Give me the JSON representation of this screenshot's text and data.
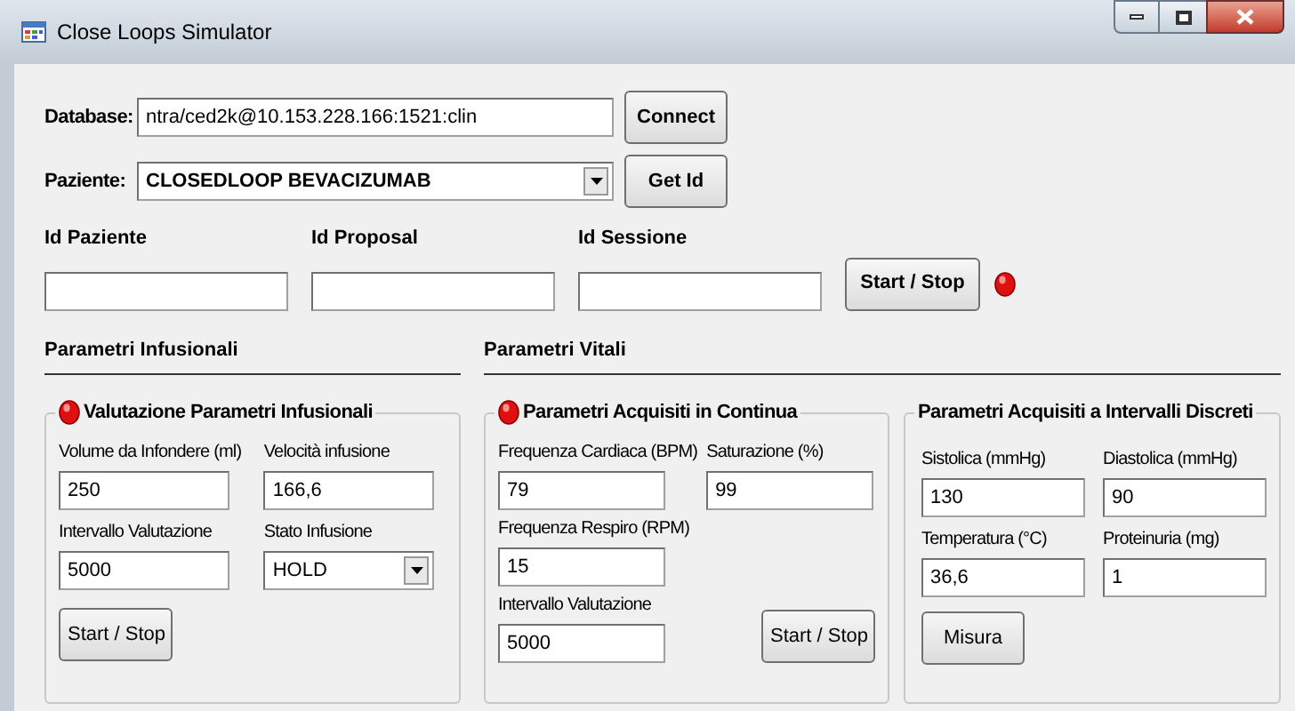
{
  "window": {
    "title": "Close Loops Simulator"
  },
  "database": {
    "label": "Database:",
    "value": "ntra/ced2k@10.153.228.166:1521:clin",
    "button": "Connect"
  },
  "patient": {
    "label": "Paziente:",
    "value": "CLOSEDLOOP BEVACIZUMAB",
    "button": "Get Id"
  },
  "ids": [
    {
      "label": "Id Paziente"
    },
    {
      "label": "Id Proposal"
    },
    {
      "label": "Id Sessione"
    }
  ],
  "session": {
    "button": "Start / Stop",
    "indicator_on": true
  },
  "infusion": {
    "title": "Parametri Infusionali",
    "group": {
      "title": "Valutazione Parametri Infusionali",
      "indicator_on": true,
      "fields": [
        {
          "kind": "text",
          "label": "Volume da Infondere (ml)",
          "value": "250"
        },
        {
          "kind": "text",
          "label": "Velocità infusione",
          "value": "166,6"
        },
        {
          "kind": "text",
          "label": "Intervallo Valutazione",
          "value": "5000"
        },
        {
          "kind": "dropdown",
          "label": "Stato Infusione",
          "value": "HOLD"
        }
      ],
      "button": "Start / Stop"
    }
  },
  "vitals": {
    "title": "Parametri Vitali",
    "continuous": {
      "title": "Parametri Acquisiti in Continua",
      "indicator_on": true,
      "fields": [
        {
          "kind": "text",
          "label": "Frequenza Cardiaca (BPM)",
          "value": "79"
        },
        {
          "kind": "text",
          "label": "Saturazione (%)",
          "value": "99"
        },
        {
          "kind": "text",
          "label": "Frequenza Respiro (RPM)",
          "value": "15"
        },
        {
          "kind": "blank"
        },
        {
          "kind": "text",
          "label": "Intervallo Valutazione",
          "value": "5000"
        }
      ],
      "button": "Start / Stop"
    },
    "discrete": {
      "title": "Parametri Acquisiti a Intervalli Discreti",
      "fields": [
        {
          "kind": "text",
          "label": "Sistolica (mmHg)",
          "value": "130"
        },
        {
          "kind": "text",
          "label": "Diastolica (mmHg)",
          "value": "90"
        },
        {
          "kind": "text",
          "label": "Temperatura (°C)",
          "value": "36,6"
        },
        {
          "kind": "text",
          "label": "Proteinuria (mg)",
          "value": "1"
        }
      ],
      "button": "Misura"
    }
  }
}
